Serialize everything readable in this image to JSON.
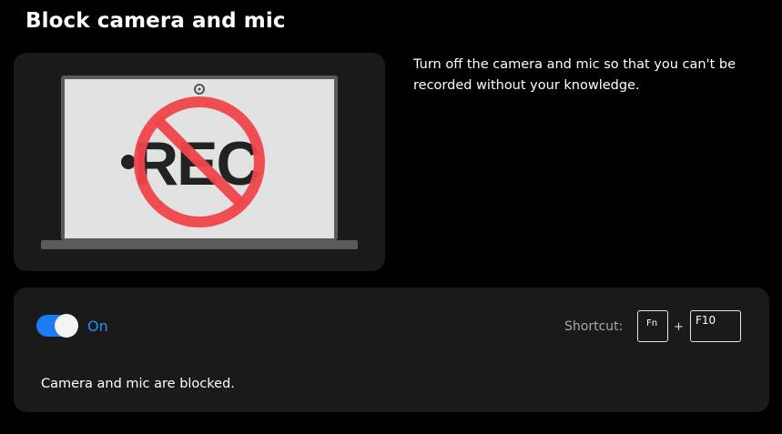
{
  "page": {
    "title": "Block camera and mic",
    "description": "Turn off the camera and mic so that you can't be recorded without your knowledge."
  },
  "illustration": {
    "icon": "laptop-rec-blocked-icon",
    "rec_text": "REC",
    "colors": {
      "screen": "#e2e2e2",
      "bezel": "#5a5a5a",
      "prohibit": "#f0454b",
      "rec": "#222222"
    }
  },
  "control": {
    "toggle_state": "on",
    "toggle_label": "On",
    "shortcut_label": "Shortcut:",
    "keys": [
      "Fn",
      "F10"
    ],
    "plus": "+",
    "status": "Camera and mic are blocked.",
    "accent_color": "#1a7cf0"
  }
}
